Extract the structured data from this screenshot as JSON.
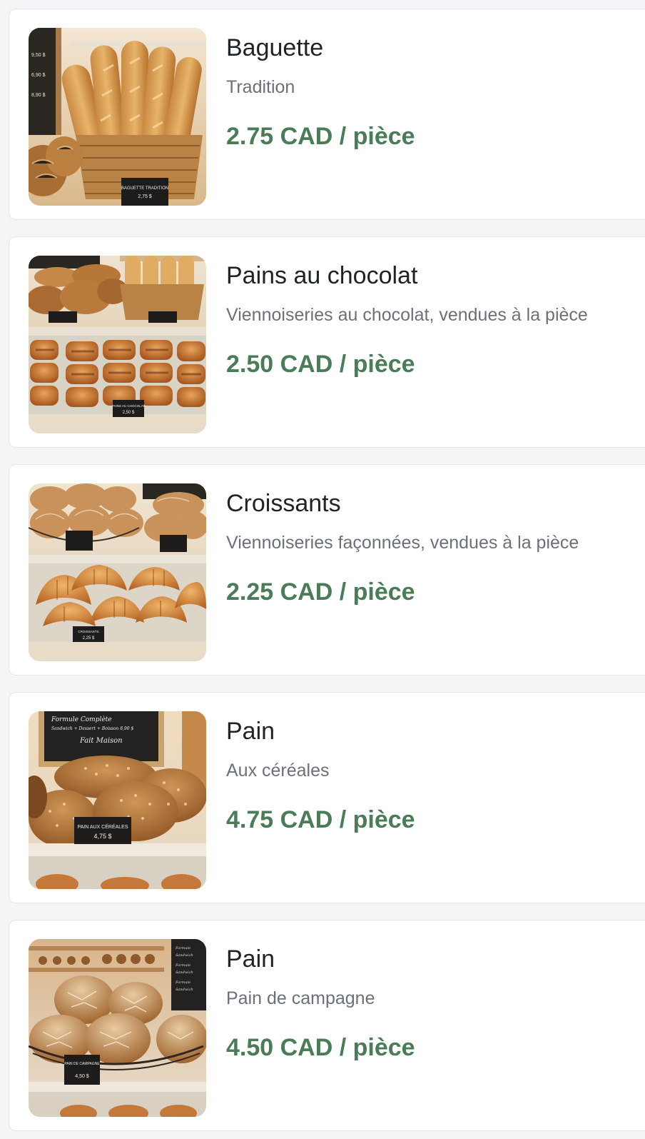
{
  "products": [
    {
      "title": "Baguette",
      "subtitle": "Tradition",
      "price": "2.75 CAD / pièce",
      "image": {
        "description": "baguettes-in-basket",
        "sign": "BAGUETTE TRADITION",
        "sign_price": "2,75 $"
      }
    },
    {
      "title": "Pains au chocolat",
      "subtitle": "Viennoiseries au chocolat, vendues à la pièce",
      "price": "2.50 CAD / pièce",
      "image": {
        "description": "pains-au-chocolat-tray",
        "sign": "PAINS AU CHOCOLAT",
        "sign_price": "2,50 $"
      }
    },
    {
      "title": "Croissants",
      "subtitle": "Viennoiseries façonnées, vendues à la pièce",
      "price": "2.25 CAD / pièce",
      "image": {
        "description": "croissants-tray",
        "sign": "CROISSANTS",
        "sign_price": "2,25 $"
      }
    },
    {
      "title": "Pain",
      "subtitle": "Aux céréales",
      "price": "4.75 CAD / pièce",
      "image": {
        "description": "multigrain-loaves",
        "sign": "PAIN AUX CÉRÉALES",
        "sign_price": "4,75 $",
        "chalkboard": [
          "Formule Complète",
          "Sandwich + Dessert + Boisson  8,90 $",
          "Fait Maison"
        ]
      }
    },
    {
      "title": "Pain",
      "subtitle": "Pain de campagne",
      "price": "4.50 CAD / pièce",
      "image": {
        "description": "country-loaves-basket",
        "sign": "PAIN DE CAMPAGNE",
        "sign_price": "4,50 $"
      }
    }
  ],
  "colors": {
    "price": "#4a7c57",
    "title": "#1f2328",
    "subtitle": "#6b7079",
    "card_bg": "#ffffff",
    "page_bg": "#f4f5f7"
  }
}
